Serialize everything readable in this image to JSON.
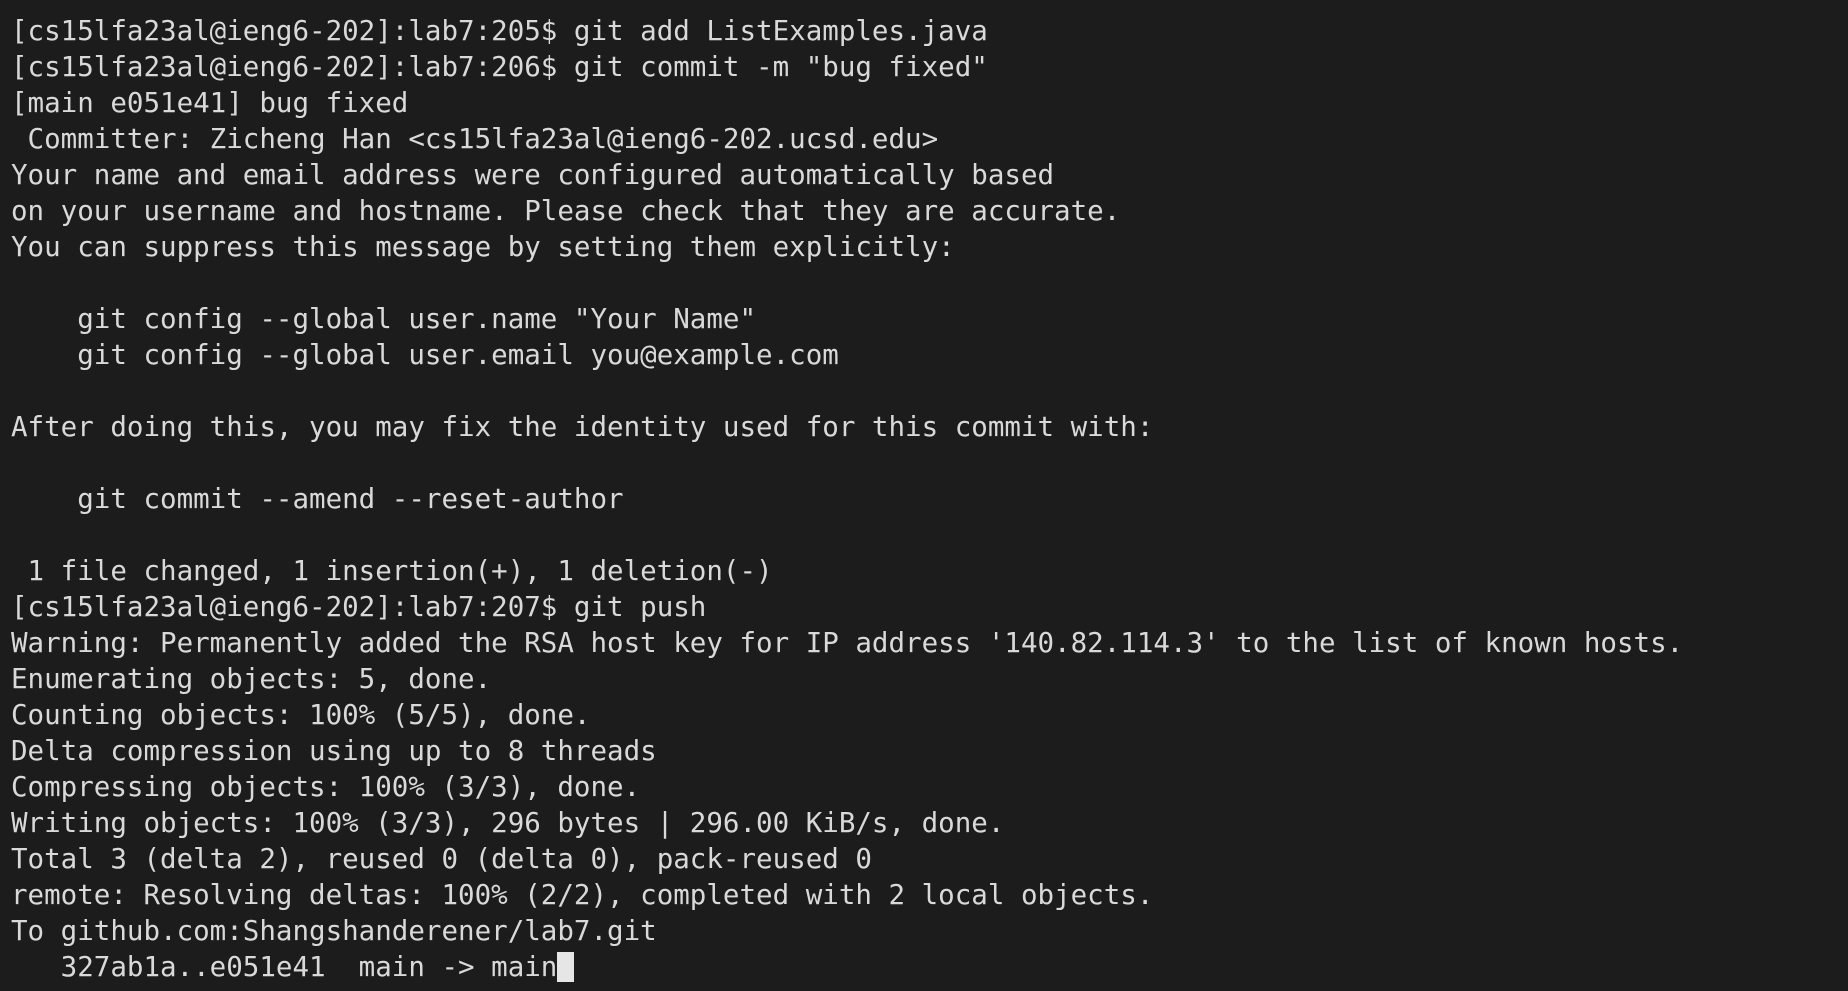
{
  "terminal": {
    "lines": [
      "[cs15lfa23al@ieng6-202]:lab7:205$ git add ListExamples.java",
      "[cs15lfa23al@ieng6-202]:lab7:206$ git commit -m \"bug fixed\"",
      "[main e051e41] bug fixed",
      " Committer: Zicheng Han <cs15lfa23al@ieng6-202.ucsd.edu>",
      "Your name and email address were configured automatically based",
      "on your username and hostname. Please check that they are accurate.",
      "You can suppress this message by setting them explicitly:",
      "",
      "    git config --global user.name \"Your Name\"",
      "    git config --global user.email you@example.com",
      "",
      "After doing this, you may fix the identity used for this commit with:",
      "",
      "    git commit --amend --reset-author",
      "",
      " 1 file changed, 1 insertion(+), 1 deletion(-)",
      "[cs15lfa23al@ieng6-202]:lab7:207$ git push",
      "Warning: Permanently added the RSA host key for IP address '140.82.114.3' to the list of known hosts.",
      "Enumerating objects: 5, done.",
      "Counting objects: 100% (5/5), done.",
      "Delta compression using up to 8 threads",
      "Compressing objects: 100% (3/3), done.",
      "Writing objects: 100% (3/3), 296 bytes | 296.00 KiB/s, done.",
      "Total 3 (delta 2), reused 0 (delta 0), pack-reused 0",
      "remote: Resolving deltas: 100% (2/2), completed with 2 local objects.",
      "To github.com:Shangshanderener/lab7.git",
      "   327ab1a..e051e41  main -> main"
    ]
  },
  "colors": {
    "background": "#1c1c1c",
    "foreground": "#d9d9d9",
    "cursor": "#e6e6e6"
  }
}
